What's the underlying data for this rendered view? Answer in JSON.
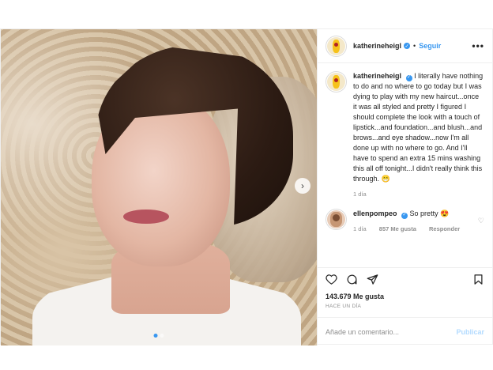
{
  "post": {
    "username": "katherineheigl",
    "follow_label": "Seguir",
    "separator": "•",
    "more_label": "•••",
    "caption": "I literally have nothing to do and no where to go today but I was dying to play with my new haircut...once it was all styled and pretty I figured I should complete the look with a touch of lipstick...and foundation...and blush...and brows...and eye shadow...now I'm all done up with no where to go. And I'll have to spend an extra 15 mins washing this all off tonight...I didn't really think this through. 😁",
    "caption_time": "1 día",
    "comment": {
      "username": "ellenpompeo",
      "text": "So pretty 😍",
      "time": "1 día",
      "likes": "857 Me gusta",
      "reply_label": "Responder"
    },
    "likes": "143.679 Me gusta",
    "posted": "HACE UN DÍA",
    "comment_placeholder": "Añade un comentario...",
    "publish_label": "Publicar"
  },
  "icons": {
    "next": "chevron-right-icon",
    "like": "heart-icon",
    "comment": "comment-icon",
    "share": "share-icon",
    "save": "bookmark-icon"
  },
  "colors": {
    "accent": "#3897f0",
    "muted": "#8e8e8e",
    "text": "#262626"
  }
}
